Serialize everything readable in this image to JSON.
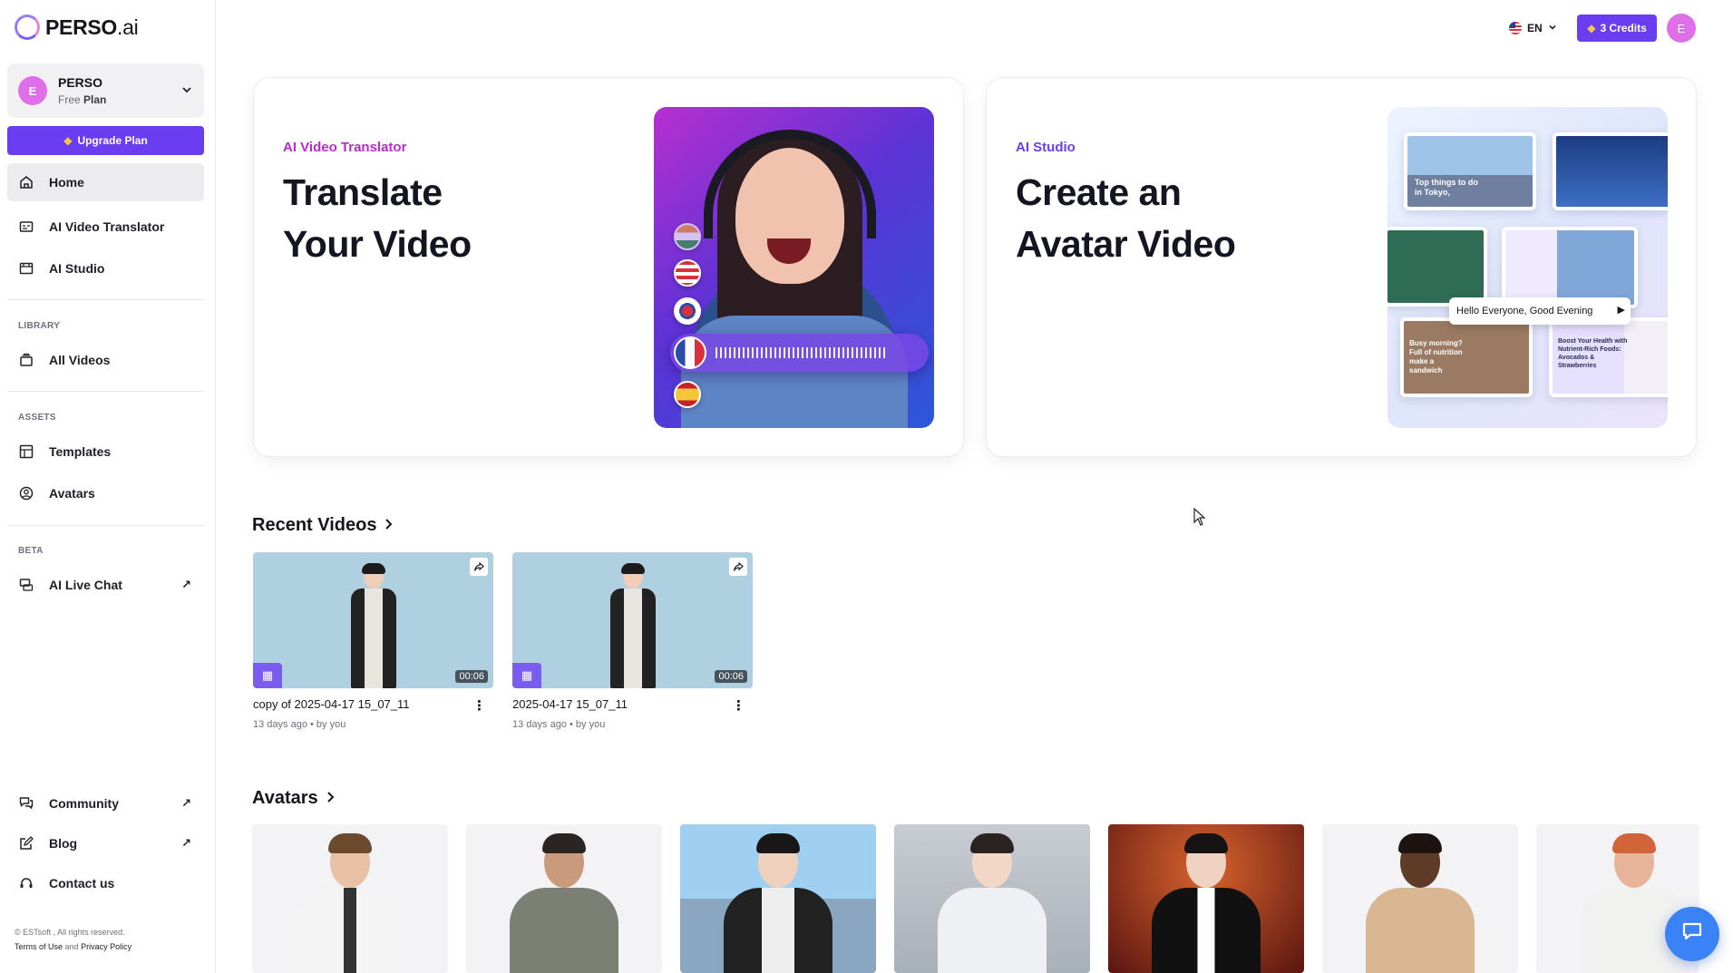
{
  "brand": {
    "logo_main": "PERSO",
    "logo_suffix": ".ai"
  },
  "workspace": {
    "initial": "E",
    "name": "PERSO",
    "plan_prefix": "Free",
    "plan_word": "Plan"
  },
  "upgrade_label": "Upgrade Plan",
  "nav": {
    "home": "Home",
    "video_translator": "AI Video Translator",
    "studio": "AI Studio",
    "library_label": "LIBRARY",
    "all_videos": "All Videos",
    "assets_label": "ASSETS",
    "templates": "Templates",
    "avatars": "Avatars",
    "beta_label": "BETA",
    "live_chat": "AI Live Chat",
    "community": "Community",
    "blog": "Blog",
    "contact": "Contact us"
  },
  "footer": {
    "copyright": "© ESTsoft , All rights reserved.",
    "terms": "Terms of Use",
    "and": "and",
    "privacy": "Privacy Policy"
  },
  "header": {
    "lang": "EN",
    "credits": "3 Credits",
    "user_initial": "E"
  },
  "cards": {
    "translator": {
      "eyebrow": "AI Video Translator",
      "title_line1": "Translate",
      "title_line2": "Your Video"
    },
    "studio": {
      "eyebrow": "AI Studio",
      "title_line1": "Create an",
      "title_line2": "Avatar Video",
      "tile1_caption": "Top things to do  in Tokyo,",
      "tile5_caption": "Busy morning? Full of nutrition make a sandwich",
      "tile6_caption": "Boost Your Health with Nutrient-Rich Foods: Avocados & Strawberries",
      "speech": "Hello Everyone, Good Evening"
    }
  },
  "recent": {
    "title": "Recent Videos",
    "videos": [
      {
        "name": "copy of 2025-04-17 15_07_11",
        "duration": "00:06",
        "age": "13 days ago",
        "sep": "•",
        "by": "by you"
      },
      {
        "name": "2025-04-17 15_07_11",
        "duration": "00:06",
        "age": "13 days ago",
        "sep": "•",
        "by": "by you"
      }
    ]
  },
  "avatars_section": {
    "title": "Avatars"
  },
  "colors": {
    "accent": "#6a3ef0",
    "translator_accent": "#b82ccc",
    "avatar_bg": "#df6fe9",
    "chat_fab": "#3b82f6"
  },
  "icons": [
    "home-icon",
    "translator-icon",
    "studio-icon",
    "videos-icon",
    "templates-icon",
    "avatars-icon",
    "live-chat-icon",
    "community-icon",
    "blog-icon",
    "contact-icon",
    "external-link-icon",
    "share-icon",
    "kebab-icon",
    "chat-icon"
  ]
}
